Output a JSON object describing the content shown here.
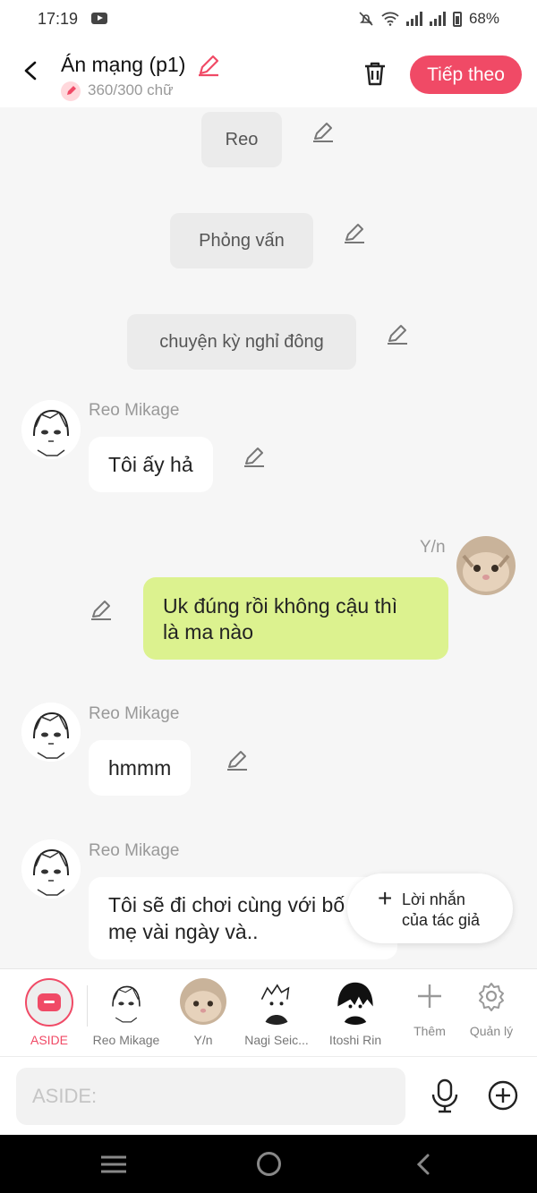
{
  "status_bar": {
    "time": "17:19",
    "battery": "68%"
  },
  "header": {
    "title": "Án mạng (p1)",
    "word_count": "360/300 chữ",
    "next_label": "Tiếp theo"
  },
  "chat": {
    "narration": [
      "Reo",
      "Phỏng vấn",
      "chuyện kỳ nghỉ đông"
    ],
    "messages": [
      {
        "sender": "Reo Mikage",
        "text": "Tôi ấy hả"
      },
      {
        "sender": "Y/n",
        "text_lines": [
          "Uk đúng rồi không cậu thì",
          "là ma nào"
        ]
      },
      {
        "sender": "Reo Mikage",
        "text": "hmmm"
      },
      {
        "sender": "Reo Mikage",
        "text_lines": [
          "Tôi sẽ đi chơi cùng với bố",
          "mẹ vài ngày và.."
        ]
      }
    ],
    "author_note": {
      "line1": "Lời nhắn",
      "line2": "của tác giả"
    }
  },
  "characters": [
    {
      "label": "ASIDE"
    },
    {
      "label": "Reo Mikage"
    },
    {
      "label": "Y/n"
    },
    {
      "label": "Nagi Seic..."
    },
    {
      "label": "Itoshi Rin"
    }
  ],
  "tools": {
    "add_label": "Thêm",
    "manage_label": "Quản lý"
  },
  "input": {
    "placeholder": "ASIDE:"
  },
  "colors": {
    "accent": "#f04a66",
    "own_bubble": "#dcf28f",
    "background": "#f6f6f6"
  },
  "icons": [
    "back-icon",
    "pencil-icon",
    "trash-icon",
    "mic-icon",
    "add-circle-icon",
    "plus-icon",
    "gear-icon",
    "menu-icon",
    "home-icon"
  ]
}
